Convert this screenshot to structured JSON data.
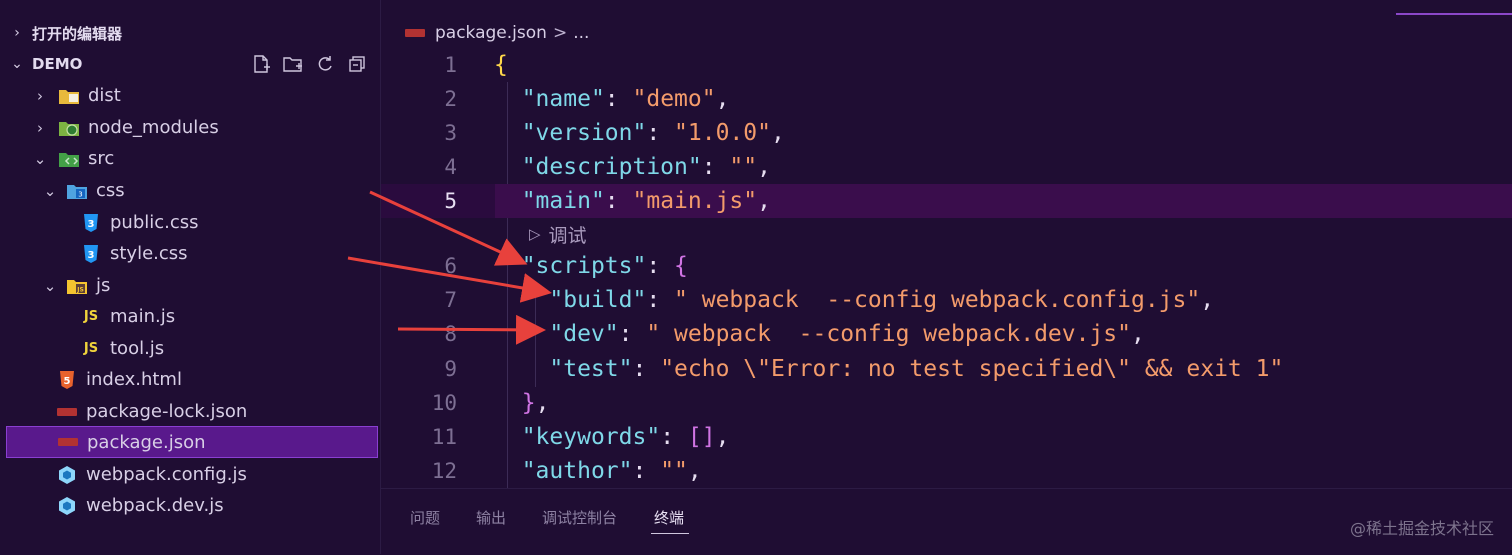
{
  "sidebar": {
    "sections": [
      {
        "label": "打开的编辑器",
        "chevron": "chevron-right-icon"
      },
      {
        "label": "DEMO",
        "chevron": "chevron-down-icon"
      }
    ],
    "actions": [
      "new-file-icon",
      "new-folder-icon",
      "refresh-icon",
      "collapse-all-icon"
    ],
    "tree": [
      {
        "label": "dist",
        "type": "folder",
        "expanded": false,
        "icon": "folder-dist-icon"
      },
      {
        "label": "node_modules",
        "type": "folder",
        "expanded": false,
        "icon": "folder-node-icon"
      },
      {
        "label": "src",
        "type": "folder",
        "expanded": true,
        "icon": "folder-src-icon"
      },
      {
        "label": "css",
        "type": "folder",
        "expanded": true,
        "icon": "folder-css-icon"
      },
      {
        "label": "public.css",
        "type": "file",
        "icon": "css-file-icon"
      },
      {
        "label": "style.css",
        "type": "file",
        "icon": "css-file-icon"
      },
      {
        "label": "js",
        "type": "folder",
        "expanded": true,
        "icon": "folder-js-icon"
      },
      {
        "label": "main.js",
        "type": "file",
        "icon": "js-file-icon",
        "badge": "JS"
      },
      {
        "label": "tool.js",
        "type": "file",
        "icon": "js-file-icon",
        "badge": "JS"
      },
      {
        "label": "index.html",
        "type": "file",
        "icon": "html-file-icon",
        "badge": "5"
      },
      {
        "label": "package-lock.json",
        "type": "file",
        "icon": "npm-icon"
      },
      {
        "label": "package.json",
        "type": "file",
        "icon": "npm-icon",
        "selected": true
      },
      {
        "label": "webpack.config.js",
        "type": "file",
        "icon": "webpack-icon"
      },
      {
        "label": "webpack.dev.js",
        "type": "file",
        "icon": "webpack-icon"
      }
    ]
  },
  "editor": {
    "breadcrumb": {
      "file": "package.json",
      "separator": ">",
      "rest": "..."
    },
    "codelens": "调试",
    "lines": [
      {
        "n": "1",
        "parts": [
          [
            "b1",
            "{"
          ]
        ]
      },
      {
        "n": "2",
        "parts": [
          [
            "p",
            "  "
          ],
          [
            "k",
            "\"name\""
          ],
          [
            "p",
            ": "
          ],
          [
            "s",
            "\"demo\""
          ],
          [
            "p",
            ","
          ]
        ]
      },
      {
        "n": "3",
        "parts": [
          [
            "p",
            "  "
          ],
          [
            "k",
            "\"version\""
          ],
          [
            "p",
            ": "
          ],
          [
            "s",
            "\"1.0.0\""
          ],
          [
            "p",
            ","
          ]
        ]
      },
      {
        "n": "4",
        "parts": [
          [
            "p",
            "  "
          ],
          [
            "k",
            "\"description\""
          ],
          [
            "p",
            ": "
          ],
          [
            "s",
            "\"\""
          ],
          [
            "p",
            ","
          ]
        ]
      },
      {
        "n": "5",
        "parts": [
          [
            "p",
            "  "
          ],
          [
            "k",
            "\"main\""
          ],
          [
            "p",
            ": "
          ],
          [
            "s",
            "\"main.js\""
          ],
          [
            "p",
            ","
          ]
        ],
        "current": true
      },
      {
        "n": "6",
        "parts": [
          [
            "p",
            "  "
          ],
          [
            "k",
            "\"scripts\""
          ],
          [
            "p",
            ": "
          ],
          [
            "b2",
            "{"
          ]
        ]
      },
      {
        "n": "7",
        "parts": [
          [
            "p",
            "    "
          ],
          [
            "k",
            "\"build\""
          ],
          [
            "p",
            ": "
          ],
          [
            "s",
            "\" webpack  --config webpack.config.js\""
          ],
          [
            "p",
            ","
          ]
        ]
      },
      {
        "n": "8",
        "parts": [
          [
            "p",
            "    "
          ],
          [
            "k",
            "\"dev\""
          ],
          [
            "p",
            ": "
          ],
          [
            "s",
            "\" webpack  --config webpack.dev.js\""
          ],
          [
            "p",
            ","
          ]
        ]
      },
      {
        "n": "9",
        "parts": [
          [
            "p",
            "    "
          ],
          [
            "k",
            "\"test\""
          ],
          [
            "p",
            ": "
          ],
          [
            "s",
            "\"echo \\\"Error: no test specified\\\" && exit 1\""
          ]
        ]
      },
      {
        "n": "10",
        "parts": [
          [
            "p",
            "  "
          ],
          [
            "b2",
            "}"
          ],
          [
            "p",
            ","
          ]
        ]
      },
      {
        "n": "11",
        "parts": [
          [
            "p",
            "  "
          ],
          [
            "k",
            "\"keywords\""
          ],
          [
            "p",
            ": "
          ],
          [
            "b2",
            "[]"
          ],
          [
            "p",
            ","
          ]
        ]
      },
      {
        "n": "12",
        "parts": [
          [
            "p",
            "  "
          ],
          [
            "k",
            "\"author\""
          ],
          [
            "p",
            ": "
          ],
          [
            "s",
            "\"\""
          ],
          [
            "p",
            ","
          ]
        ]
      }
    ]
  },
  "panel": {
    "tabs": [
      "问题",
      "输出",
      "调试控制台",
      "终端"
    ],
    "active": "终端"
  },
  "watermark": "@稀土掘金技术社区",
  "colors": {
    "background": "#1f0d33",
    "selection": "#59198c",
    "key": "#7fd8e8",
    "string": "#f39b6b",
    "arrow": "#e8413c"
  }
}
